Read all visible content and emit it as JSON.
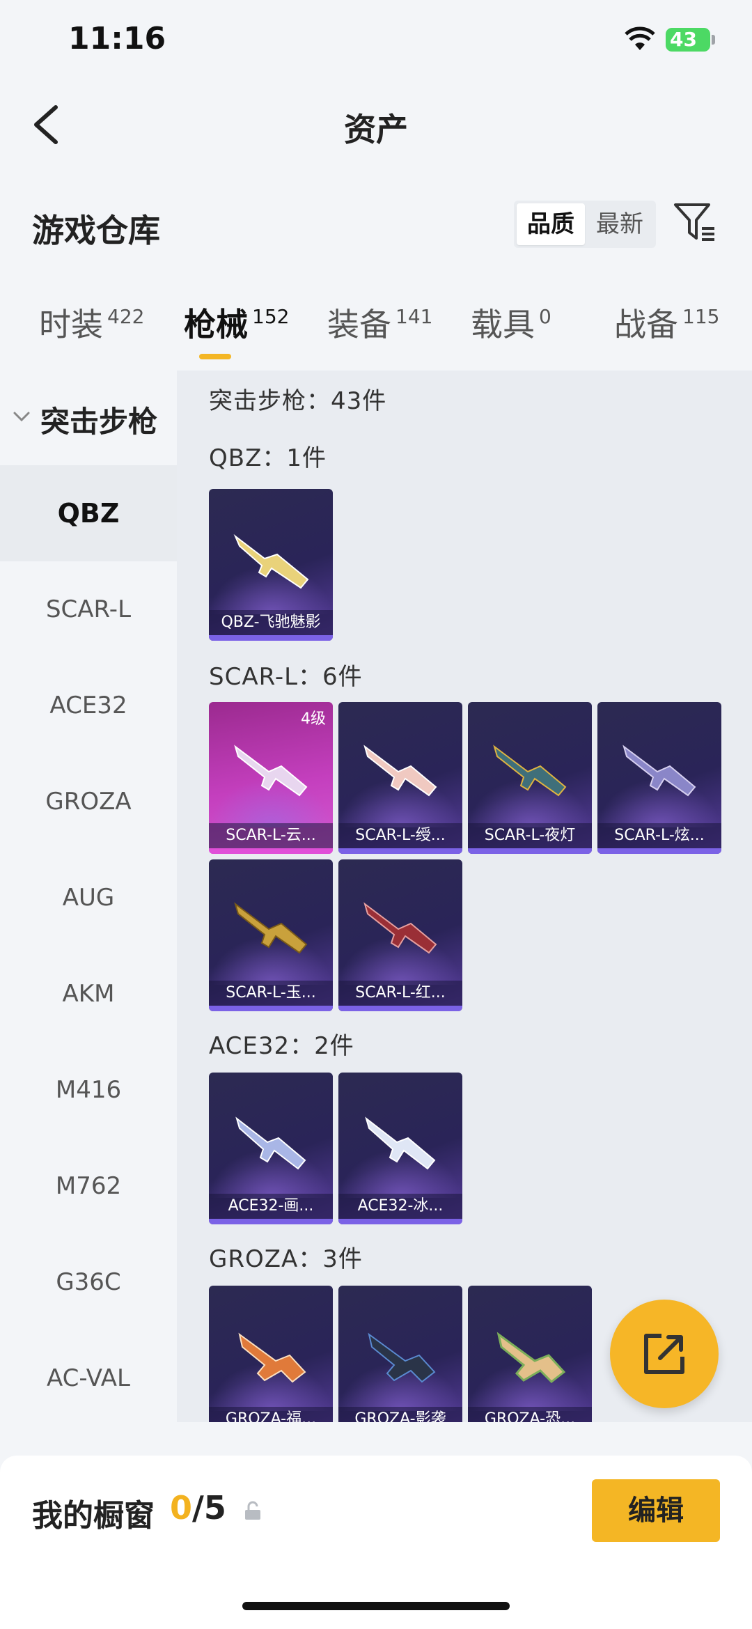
{
  "status": {
    "time": "11:16",
    "battery": "43"
  },
  "header": {
    "title": "资产"
  },
  "warehouse": {
    "title": "游戏仓库",
    "sort_options": [
      "品质",
      "最新"
    ],
    "sort_selected": "品质"
  },
  "tabs": [
    {
      "label": "时装",
      "count": "422"
    },
    {
      "label": "枪械",
      "count": "152",
      "active": true
    },
    {
      "label": "装备",
      "count": "141"
    },
    {
      "label": "载具",
      "count": "0"
    },
    {
      "label": "战备",
      "count": "115"
    }
  ],
  "sidebar": {
    "group": "突击步枪",
    "items": [
      "QBZ",
      "SCAR-L",
      "ACE32",
      "GROZA",
      "AUG",
      "AKM",
      "M416",
      "M762",
      "G36C",
      "AC-VAL"
    ],
    "selected": "QBZ"
  },
  "content": {
    "summary": "突击步枪：43件",
    "sections": [
      {
        "label": "QBZ：1件",
        "items": [
          {
            "name": "QBZ-飞驰魅影"
          }
        ]
      },
      {
        "label": "SCAR-L：6件",
        "items": [
          {
            "name": "SCAR-L-云...",
            "level": "4级"
          },
          {
            "name": "SCAR-L-绶..."
          },
          {
            "name": "SCAR-L-夜灯"
          },
          {
            "name": "SCAR-L-炫..."
          },
          {
            "name": "SCAR-L-玉..."
          },
          {
            "name": "SCAR-L-红..."
          }
        ]
      },
      {
        "label": "ACE32：2件",
        "items": [
          {
            "name": "ACE32-画..."
          },
          {
            "name": "ACE32-冰..."
          }
        ]
      },
      {
        "label": "GROZA：3件",
        "items": [
          {
            "name": "GROZA-福..."
          },
          {
            "name": "GROZA-影袭"
          },
          {
            "name": "GROZA-恐..."
          }
        ]
      }
    ]
  },
  "showcase": {
    "title": "我的橱窗",
    "count": "0",
    "total": "/5",
    "edit_label": "编辑"
  },
  "colors": {
    "accent": "#f4b625",
    "card_bg": "#2a2458",
    "card_pink": "#c43fbe"
  }
}
